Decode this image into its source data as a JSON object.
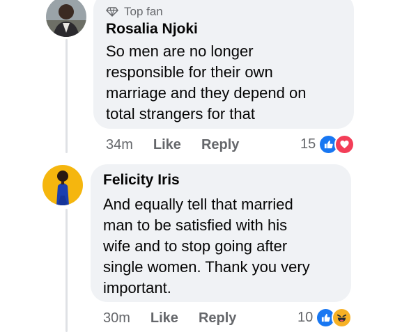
{
  "comments": [
    {
      "badge": "Top fan",
      "author": "Rosalia Njoki",
      "text": "So men are no longer\nresponsible for their own\nmarriage and they depend on\ntotal strangers for that",
      "time": "34m",
      "like_label": "Like",
      "reply_label": "Reply",
      "reaction_count": "15",
      "reactions": [
        "like-icon",
        "love-icon"
      ]
    },
    {
      "author": "Felicity Iris",
      "text": "And equally tell that married\nman to be satisfied with his\nwife and to stop going after\nsingle women. Thank you very\nimportant.",
      "time": "30m",
      "like_label": "Like",
      "reply_label": "Reply",
      "reaction_count": "10",
      "reactions": [
        "like-icon",
        "haha-icon"
      ]
    }
  ],
  "colors": {
    "like": "#1877f2",
    "love": "#f33e58",
    "haha": "#f7b125",
    "bubble": "#f0f2f5",
    "meta": "#65676b"
  }
}
